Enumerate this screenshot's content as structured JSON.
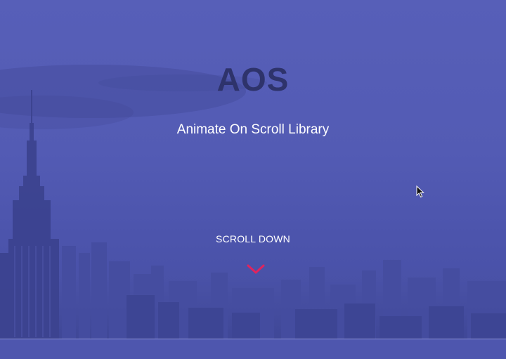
{
  "hero": {
    "title": "AOS",
    "subtitle": "Animate On Scroll Library",
    "scroll_label": "SCROLL DOWN",
    "scroll_icon": "chevron-down-icon"
  },
  "colors": {
    "overlay": "#5158b0",
    "title": "#2e336b",
    "text": "#ffffff",
    "accent": "#e0245e"
  },
  "next_section": {
    "heading": ""
  }
}
